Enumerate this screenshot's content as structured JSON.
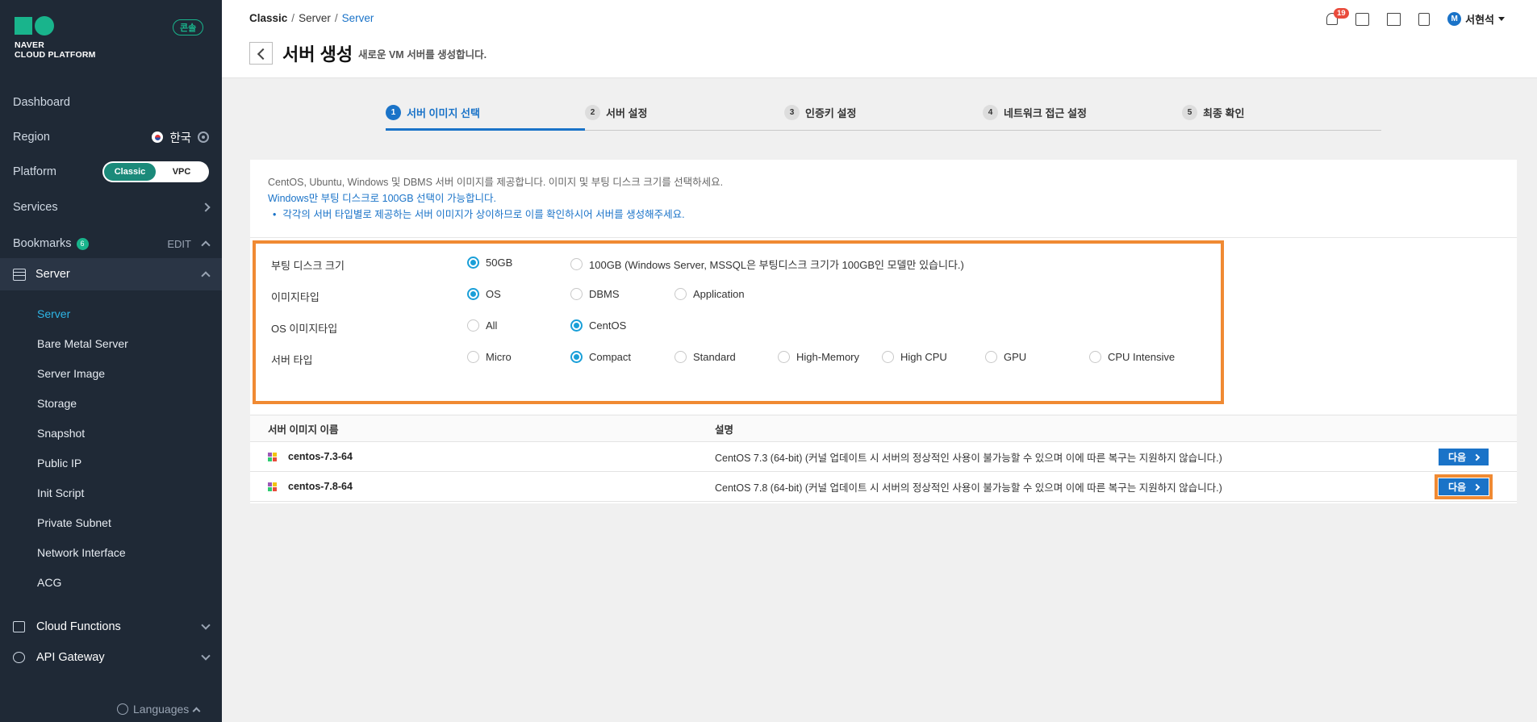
{
  "sidebar": {
    "logo_line1": "NAVER",
    "logo_line2": "CLOUD PLATFORM",
    "console_badge": "콘솔",
    "dashboard": "Dashboard",
    "region_label": "Region",
    "region_value": "한국",
    "platform_label": "Platform",
    "platform_options": [
      "Classic",
      "VPC"
    ],
    "platform_selected": "Classic",
    "services": "Services",
    "bookmarks": "Bookmarks",
    "bookmarks_count": "6",
    "bookmarks_edit": "EDIT",
    "server_section": "Server",
    "server_items": [
      "Server",
      "Bare Metal Server",
      "Server Image",
      "Storage",
      "Snapshot",
      "Public IP",
      "Init Script",
      "Private Subnet",
      "Network Interface",
      "ACG"
    ],
    "active_item": "Server",
    "cloud_functions": "Cloud Functions",
    "api_gateway": "API Gateway",
    "languages": "Languages"
  },
  "header": {
    "breadcrumb": [
      "Classic",
      "Server",
      "Server"
    ],
    "title": "서버 생성",
    "subtitle": "새로운 VM 서버를 생성합니다.",
    "notification_count": "19",
    "user_initial": "M",
    "user_name": "서현석"
  },
  "steps": [
    {
      "num": "1",
      "label": "서버 이미지 선택"
    },
    {
      "num": "2",
      "label": "서버 설정"
    },
    {
      "num": "3",
      "label": "인증키 설정"
    },
    {
      "num": "4",
      "label": "네트워크 접근 설정"
    },
    {
      "num": "5",
      "label": "최종 확인"
    }
  ],
  "info": {
    "line1": "CentOS, Ubuntu, Windows 및 DBMS 서버 이미지를 제공합니다. 이미지 및 부팅 디스크 크기를 선택하세요.",
    "line2": "Windows만 부팅 디스크로 100GB 선택이 가능합니다.",
    "line3": "각각의 서버 타입별로 제공하는 서버 이미지가 상이하므로 이를 확인하시어 서버를 생성해주세요."
  },
  "options": {
    "boot_disk": {
      "label": "부팅 디스크 크기",
      "choices": [
        "50GB",
        "100GB (Windows Server, MSSQL은 부팅디스크 크기가 100GB인 모델만 있습니다.)"
      ],
      "selected": 0
    },
    "image_type": {
      "label": "이미지타입",
      "choices": [
        "OS",
        "DBMS",
        "Application"
      ],
      "selected": 0
    },
    "os_image_type": {
      "label": "OS 이미지타입",
      "choices": [
        "All",
        "CentOS"
      ],
      "selected": 1
    },
    "server_type": {
      "label": "서버 타입",
      "choices": [
        "Micro",
        "Compact",
        "Standard",
        "High-Memory",
        "High CPU",
        "GPU",
        "CPU Intensive"
      ],
      "selected": 1
    }
  },
  "table": {
    "headers": [
      "서버 이미지 이름",
      "설명"
    ],
    "rows": [
      {
        "name": "centos-7.3-64",
        "desc": "CentOS 7.3 (64-bit) (커널 업데이트 시 서버의 정상적인 사용이 불가능할 수 있으며 이에 따른 복구는 지원하지 않습니다.)",
        "button": "다음"
      },
      {
        "name": "centos-7.8-64",
        "desc": "CentOS 7.8 (64-bit) (커널 업데이트 시 서버의 정상적인 사용이 불가능할 수 있으며 이에 따른 복구는 지원하지 않습니다.)",
        "button": "다음"
      }
    ]
  },
  "icons": {
    "notification": "bell-icon",
    "chat": "chat-icon",
    "memo": "memo-icon",
    "book": "book-icon",
    "settings": "gear-icon",
    "back": "chevron-left-icon"
  },
  "colors": {
    "accent": "#1a73c8",
    "brand": "#19b48c",
    "highlight": "#f08a33",
    "sidebar_bg": "#1f2936"
  }
}
